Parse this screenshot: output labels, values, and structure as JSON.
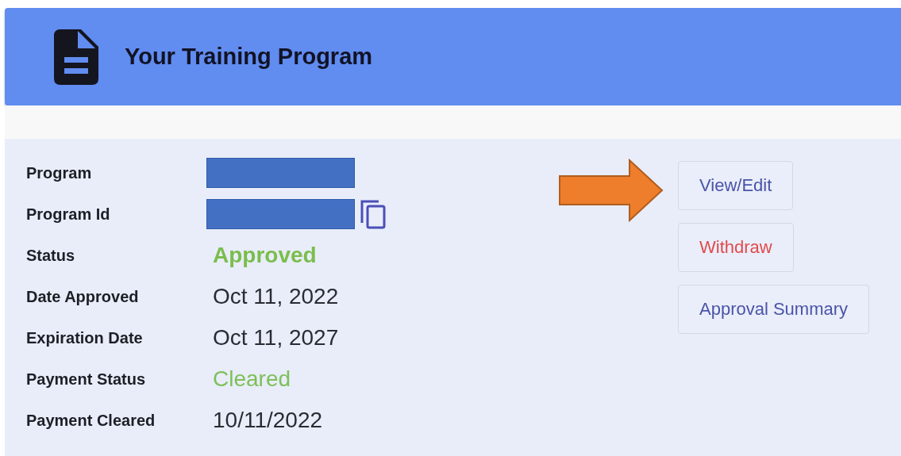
{
  "header": {
    "title": "Your Training Program"
  },
  "details": [
    {
      "label": "Program",
      "kind": "redacted"
    },
    {
      "label": "Program Id",
      "kind": "redacted_copy"
    },
    {
      "label": "Status",
      "kind": "status",
      "value": "Approved"
    },
    {
      "label": "Date Approved",
      "kind": "text",
      "value": "Oct 11, 2022"
    },
    {
      "label": "Expiration Date",
      "kind": "text",
      "value": "Oct 11, 2027"
    },
    {
      "label": "Payment Status",
      "kind": "success",
      "value": "Cleared"
    },
    {
      "label": "Payment Cleared",
      "kind": "text",
      "value": "10/11/2022"
    }
  ],
  "actions": [
    {
      "label": "View/Edit",
      "kind": "primary"
    },
    {
      "label": "Withdraw",
      "kind": "danger"
    },
    {
      "label": "Approval Summary",
      "kind": "primary"
    }
  ]
}
